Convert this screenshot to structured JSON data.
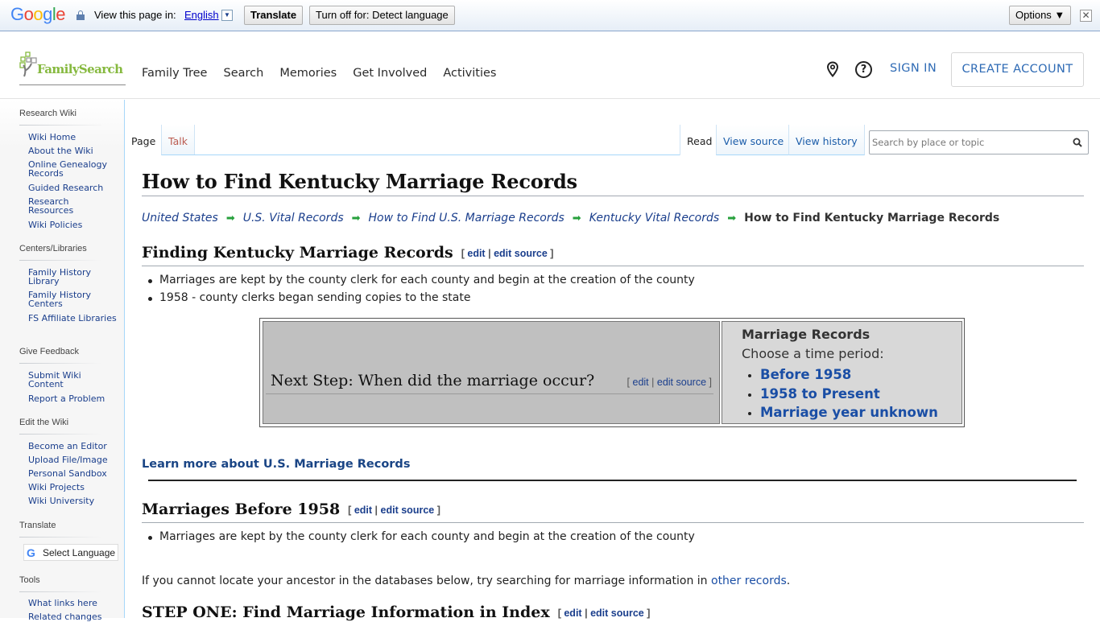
{
  "translate_bar": {
    "brand": "Google",
    "view_label": "View this page in:",
    "language": "English",
    "translate_button": "Translate",
    "turn_off_button": "Turn off for: Detect language",
    "options_button": "Options ▼",
    "close_glyph": "✕"
  },
  "header": {
    "logo_text": "FamilySearch",
    "nav": [
      "Family Tree",
      "Search",
      "Memories",
      "Get Involved",
      "Activities"
    ],
    "help_glyph": "?",
    "sign_in": "SIGN IN",
    "create_account": "CREATE ACCOUNT"
  },
  "sidebar": {
    "sections": [
      {
        "heading": "Research Wiki",
        "links": [
          "Wiki Home",
          "About the Wiki",
          "Online Genealogy Records",
          "Guided Research",
          "Research Resources",
          "Wiki Policies"
        ]
      },
      {
        "heading": "Centers/Libraries",
        "links": [
          "Family History Library",
          "Family History Centers",
          "FS Affiliate Libraries"
        ]
      },
      {
        "heading": "Give Feedback",
        "links": [
          "Submit Wiki Content",
          "Report a Problem"
        ]
      },
      {
        "heading": "Edit the Wiki",
        "links": [
          "Become an Editor",
          "Upload File/Image",
          "Personal Sandbox",
          "Wiki Projects",
          "Wiki University"
        ]
      },
      {
        "heading": "Translate",
        "select_language": "Select Language"
      },
      {
        "heading": "Tools",
        "links": [
          "What links here",
          "Related changes"
        ]
      }
    ]
  },
  "tabs": {
    "left": [
      "Page",
      "Talk"
    ],
    "right": [
      "Read",
      "View source",
      "View history"
    ],
    "search_placeholder": "Search by place or topic"
  },
  "content": {
    "title": "How to Find Kentucky Marriage Records",
    "breadcrumb": [
      "United States",
      "U.S. Vital Records",
      "How to Find U.S. Marriage Records",
      "Kentucky Vital Records"
    ],
    "breadcrumb_current": "How to Find Kentucky Marriage Records",
    "edit": {
      "open": "[",
      "edit": "edit",
      "sep": "|",
      "edit_source": "edit source",
      "close": "]"
    },
    "section1": {
      "heading": "Finding Kentucky Marriage Records",
      "bullets": [
        "Marriages are kept by the county clerk for each county and begin at the creation of the county",
        "1958 - county clerks began sending copies to the state"
      ]
    },
    "next_step": {
      "heading": "Next Step: When did the marriage occur?",
      "box_title": "Marriage Records",
      "box_subtitle": "Choose a time period:",
      "options": [
        "Before 1958",
        "1958 to Present",
        "Marriage year unknown"
      ]
    },
    "learn_more": "Learn more about U.S. Marriage Records",
    "section2": {
      "heading": "Marriages Before 1958",
      "bullets": [
        "Marriages are kept by the county clerk for each county and begin at the creation of the county"
      ]
    },
    "paragraph": {
      "text": "If you cannot locate your ancestor in the databases below, try searching for marriage information in ",
      "link": "other records",
      "end": "."
    },
    "section3": {
      "heading": "STEP ONE: Find Marriage Information in Index"
    }
  }
}
